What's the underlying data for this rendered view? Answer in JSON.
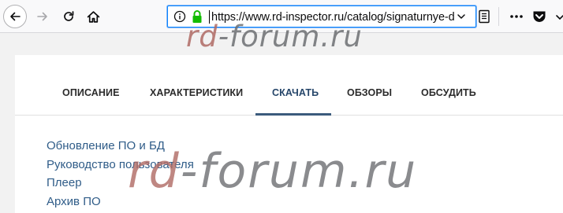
{
  "browser": {
    "url": "https://www.rd-inspector.ru/catalog/signaturnye-d",
    "icons": {
      "back": "arrow-left-icon",
      "forward": "arrow-right-icon",
      "reload": "reload-icon",
      "home": "home-icon",
      "info": "info-icon",
      "lock": "lock-icon",
      "dropdown": "chevron-down-icon",
      "reader": "reader-view-icon",
      "more": "ellipsis-icon",
      "pocket": "pocket-icon"
    },
    "colors": {
      "lock": "#12bc00",
      "urlbar_focus": "#0a84ff"
    }
  },
  "tabs": [
    {
      "label": "ОПИСАНИЕ",
      "active": false
    },
    {
      "label": "ХАРАКТЕРИСТИКИ",
      "active": false
    },
    {
      "label": "СКАЧАТЬ",
      "active": true
    },
    {
      "label": "ОБЗОРЫ",
      "active": false
    },
    {
      "label": "ОБСУДИТЬ",
      "active": false
    }
  ],
  "downloads": [
    {
      "label": "Обновление ПО и БД"
    },
    {
      "label": "Руководство пользователя"
    },
    {
      "label": "Плеер"
    },
    {
      "label": "Архив ПО"
    }
  ],
  "watermark": {
    "top": {
      "part1": "rd",
      "part2": "-forum.ru"
    },
    "middle": {
      "part1": "rd",
      "part2": "-forum.ru"
    }
  },
  "colors": {
    "link": "#2f5c88",
    "active_tab_underline": "#3b5b7c",
    "watermark_red": "#b06a64",
    "watermark_gray": "#6d6f72"
  }
}
